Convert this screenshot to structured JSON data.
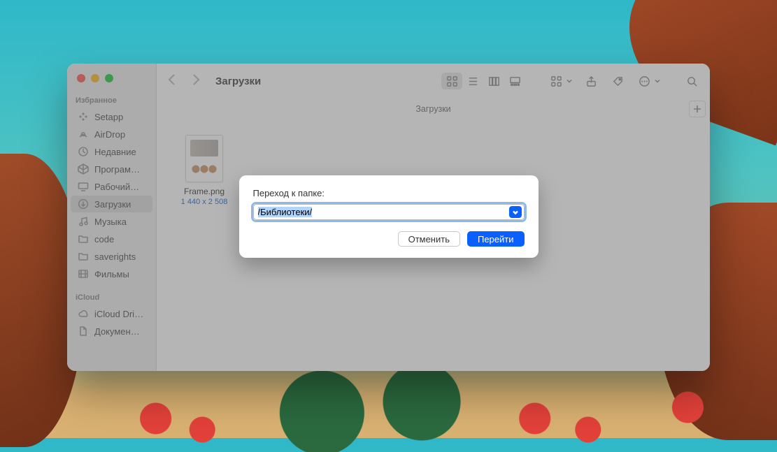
{
  "window": {
    "title": "Загрузки",
    "path_label": "Загрузки"
  },
  "sidebar": {
    "section_favorites": "Избранное",
    "section_icloud": "iCloud",
    "favorites": [
      {
        "label": "Setapp",
        "icon": "app"
      },
      {
        "label": "AirDrop",
        "icon": "airdrop"
      },
      {
        "label": "Недавние",
        "icon": "clock"
      },
      {
        "label": "Програм…",
        "icon": "apps"
      },
      {
        "label": "Рабочий…",
        "icon": "desktop"
      },
      {
        "label": "Загрузки",
        "icon": "download",
        "active": true
      },
      {
        "label": "Музыка",
        "icon": "music"
      },
      {
        "label": "code",
        "icon": "folder"
      },
      {
        "label": "saverights",
        "icon": "folder"
      },
      {
        "label": "Фильмы",
        "icon": "film"
      }
    ],
    "icloud": [
      {
        "label": "iCloud Dri…",
        "icon": "cloud"
      },
      {
        "label": "Докумен…",
        "icon": "doc"
      }
    ]
  },
  "files": [
    {
      "name": "Frame.png",
      "dimensions": "1 440 x 2 508"
    }
  ],
  "dialog": {
    "label": "Переход к папке:",
    "value": "/Библиотеки/",
    "cancel": "Отменить",
    "go": "Перейти"
  }
}
